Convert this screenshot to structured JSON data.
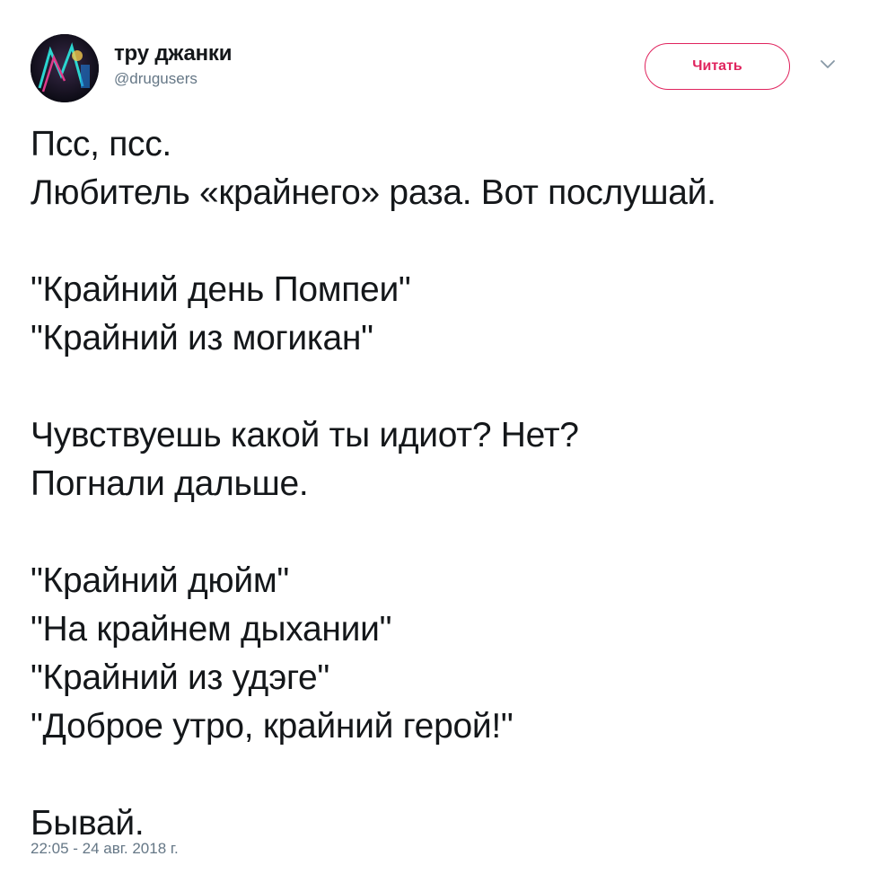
{
  "author": {
    "display_name": "тру джанки",
    "handle": "@drugusers"
  },
  "follow_button": {
    "label": "Читать",
    "color": "#e0245e"
  },
  "icons": {
    "menu": "chevron-down-icon"
  },
  "tweet": {
    "paragraphs": [
      [
        "Псс, псс.",
        "Любитель «крайнего» раза. Вот послушай."
      ],
      [
        "\"Крайний день Помпеи\"",
        "\"Крайний из могикан\""
      ],
      [
        "Чувствуешь какой ты идиот? Нет?",
        "Погнали дальше."
      ],
      [
        "\"Крайний дюйм\"",
        "\"На крайнем дыхании\"",
        "\"Крайний из удэге\"",
        "\"Доброе утро, крайний герой!\""
      ],
      [
        "Бывай."
      ]
    ],
    "timestamp": "22:05 - 24 авг. 2018 г."
  }
}
